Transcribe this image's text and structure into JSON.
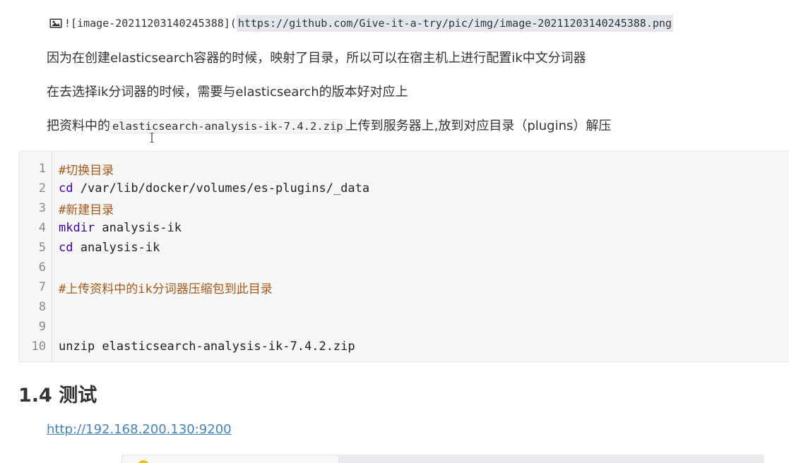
{
  "image_markdown": {
    "prefix": "![image-20211203140245388](",
    "url": "https://github.com/Give-it-a-try/pic/img/image-20211203140245388.png"
  },
  "paragraphs": {
    "p1": "因为在创建elasticsearch容器的时候，映射了目录，所以可以在宿主机上进行配置ik中文分词器",
    "p2": "在去选择ik分词器的时候，需要与elasticsearch的版本好对应上",
    "p3_before": "把资料中的",
    "p3_code": "elasticsearch-analysis-ik-7.4.2.zip",
    "p3_after": "上传到服务器上,放到对应目录（plugins）解压"
  },
  "code": {
    "lines": [
      {
        "n": "1",
        "parts": [
          {
            "t": "#切换目录",
            "c": "cm"
          }
        ]
      },
      {
        "n": "2",
        "parts": [
          {
            "t": "cd",
            "c": "kw"
          },
          {
            "t": " /var/lib/docker/volumes/es-plugins/_data",
            "c": "plain"
          }
        ]
      },
      {
        "n": "3",
        "parts": [
          {
            "t": "#新建目录",
            "c": "cm"
          }
        ]
      },
      {
        "n": "4",
        "parts": [
          {
            "t": "mkdir",
            "c": "kw"
          },
          {
            "t": " analysis-ik",
            "c": "plain"
          }
        ]
      },
      {
        "n": "5",
        "parts": [
          {
            "t": "cd",
            "c": "kw"
          },
          {
            "t": " analysis-ik",
            "c": "plain"
          }
        ]
      },
      {
        "n": "6",
        "parts": []
      },
      {
        "n": "7",
        "parts": [
          {
            "t": "#上传资料中的ik分词器压缩包到此目录",
            "c": "cm"
          }
        ]
      },
      {
        "n": "8",
        "parts": []
      },
      {
        "n": "9",
        "parts": []
      },
      {
        "n": "10",
        "parts": [
          {
            "t": "unzip elasticsearch-analysis-ik-7.4.2.zip",
            "c": "plain"
          }
        ]
      }
    ]
  },
  "heading": "1.4 测试",
  "link": "http://192.168.200.130:9200",
  "colors": {
    "comment": "#a85a1a",
    "keyword": "#3a00a8",
    "link": "#4183c4"
  }
}
